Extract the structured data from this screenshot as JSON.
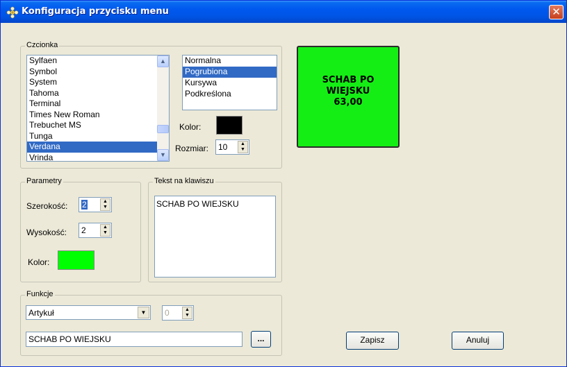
{
  "window": {
    "title": "Konfiguracja przycisku menu",
    "close_symbol": "✕"
  },
  "font_group": {
    "legend": "Czcionka",
    "fonts": [
      "Sylfaen",
      "Symbol",
      "System",
      "Tahoma",
      "Terminal",
      "Times New Roman",
      "Trebuchet MS",
      "Tunga",
      "Verdana",
      "Vrinda"
    ],
    "selected_font": "Verdana",
    "styles": [
      "Normalna",
      "Pogrubiona",
      "Kursywa",
      "Podkreślona"
    ],
    "selected_style": "Pogrubiona",
    "color_label": "Kolor:",
    "color_value": "#000000",
    "size_label": "Rozmiar:",
    "size_value": "10"
  },
  "params_group": {
    "legend": "Parametry",
    "width_label": "Szerokość:",
    "width_value": "2",
    "height_label": "Wysokość:",
    "height_value": "2",
    "color_label": "Kolor:",
    "color_value": "#00ff00"
  },
  "text_group": {
    "legend": "Tekst na klawiszu",
    "text": "SCHAB PO WIEJSKU"
  },
  "functions_group": {
    "legend": "Funkcje",
    "type_value": "Artykuł",
    "number_value": "0",
    "item_value": "SCHAB PO WIEJSKU",
    "browse_label": "..."
  },
  "preview": {
    "text": "SCHAB PO\nWIEJSKU\n63,00",
    "background": "#15ee15"
  },
  "buttons": {
    "save": "Zapisz",
    "cancel": "Anuluj"
  }
}
